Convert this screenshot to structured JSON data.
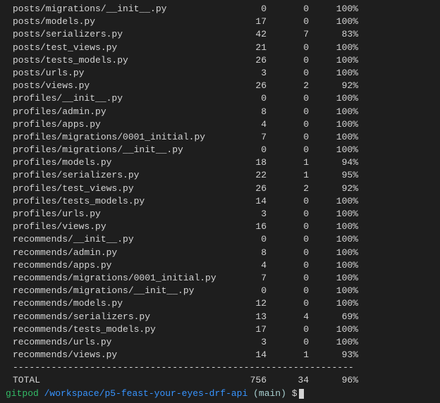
{
  "rows": [
    {
      "name": "posts/migrations/__init__.py",
      "stmts": 0,
      "miss": 0,
      "cover": "100%"
    },
    {
      "name": "posts/models.py",
      "stmts": 17,
      "miss": 0,
      "cover": "100%"
    },
    {
      "name": "posts/serializers.py",
      "stmts": 42,
      "miss": 7,
      "cover": "83%"
    },
    {
      "name": "posts/test_views.py",
      "stmts": 21,
      "miss": 0,
      "cover": "100%"
    },
    {
      "name": "posts/tests_models.py",
      "stmts": 26,
      "miss": 0,
      "cover": "100%"
    },
    {
      "name": "posts/urls.py",
      "stmts": 3,
      "miss": 0,
      "cover": "100%"
    },
    {
      "name": "posts/views.py",
      "stmts": 26,
      "miss": 2,
      "cover": "92%"
    },
    {
      "name": "profiles/__init__.py",
      "stmts": 0,
      "miss": 0,
      "cover": "100%"
    },
    {
      "name": "profiles/admin.py",
      "stmts": 8,
      "miss": 0,
      "cover": "100%"
    },
    {
      "name": "profiles/apps.py",
      "stmts": 4,
      "miss": 0,
      "cover": "100%"
    },
    {
      "name": "profiles/migrations/0001_initial.py",
      "stmts": 7,
      "miss": 0,
      "cover": "100%"
    },
    {
      "name": "profiles/migrations/__init__.py",
      "stmts": 0,
      "miss": 0,
      "cover": "100%"
    },
    {
      "name": "profiles/models.py",
      "stmts": 18,
      "miss": 1,
      "cover": "94%"
    },
    {
      "name": "profiles/serializers.py",
      "stmts": 22,
      "miss": 1,
      "cover": "95%"
    },
    {
      "name": "profiles/test_views.py",
      "stmts": 26,
      "miss": 2,
      "cover": "92%"
    },
    {
      "name": "profiles/tests_models.py",
      "stmts": 14,
      "miss": 0,
      "cover": "100%"
    },
    {
      "name": "profiles/urls.py",
      "stmts": 3,
      "miss": 0,
      "cover": "100%"
    },
    {
      "name": "profiles/views.py",
      "stmts": 16,
      "miss": 0,
      "cover": "100%"
    },
    {
      "name": "recommends/__init__.py",
      "stmts": 0,
      "miss": 0,
      "cover": "100%"
    },
    {
      "name": "recommends/admin.py",
      "stmts": 8,
      "miss": 0,
      "cover": "100%"
    },
    {
      "name": "recommends/apps.py",
      "stmts": 4,
      "miss": 0,
      "cover": "100%"
    },
    {
      "name": "recommends/migrations/0001_initial.py",
      "stmts": 7,
      "miss": 0,
      "cover": "100%"
    },
    {
      "name": "recommends/migrations/__init__.py",
      "stmts": 0,
      "miss": 0,
      "cover": "100%"
    },
    {
      "name": "recommends/models.py",
      "stmts": 12,
      "miss": 0,
      "cover": "100%"
    },
    {
      "name": "recommends/serializers.py",
      "stmts": 13,
      "miss": 4,
      "cover": "69%"
    },
    {
      "name": "recommends/tests_models.py",
      "stmts": 17,
      "miss": 0,
      "cover": "100%"
    },
    {
      "name": "recommends/urls.py",
      "stmts": 3,
      "miss": 0,
      "cover": "100%"
    },
    {
      "name": "recommends/views.py",
      "stmts": 14,
      "miss": 1,
      "cover": "93%"
    }
  ],
  "separator": "--------------------------------------------------------------",
  "total": {
    "label": "TOTAL",
    "stmts": 756,
    "miss": 34,
    "cover": "96%"
  },
  "prompt": {
    "host": "gitpod",
    "path": "/workspace/p5-feast-your-eyes-drf-api",
    "branch": "(main)",
    "symbol": "$"
  }
}
